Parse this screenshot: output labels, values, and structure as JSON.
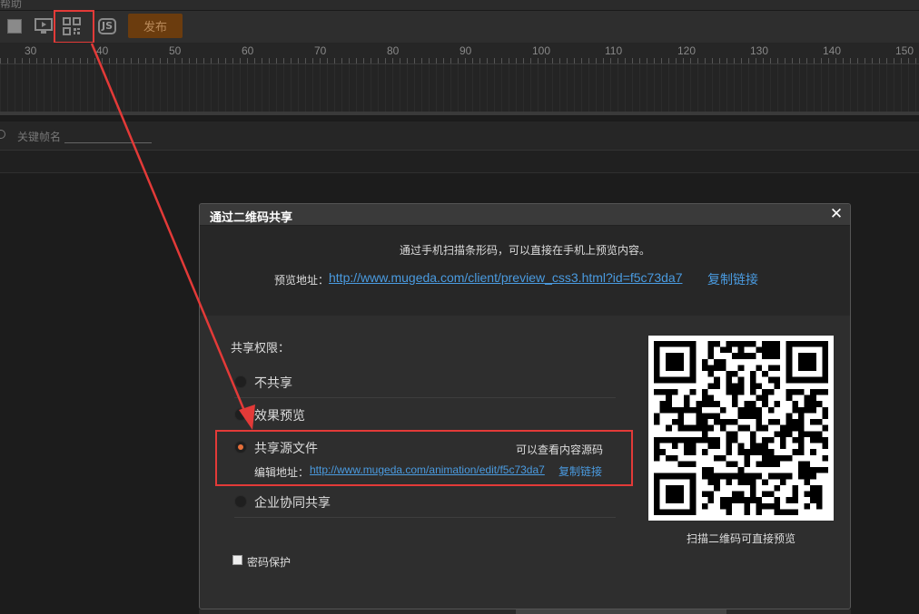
{
  "menubar": {
    "label": "帮助"
  },
  "toolbar": {
    "js_label": "JS",
    "publish_label": "发布",
    "icons": [
      "stop-icon",
      "preview-icon",
      "qrcode-icon",
      "js-icon"
    ]
  },
  "ruler": {
    "ticks": [
      "30",
      "40",
      "50",
      "60",
      "70",
      "80",
      "90",
      "100",
      "110",
      "120",
      "130",
      "140",
      "150"
    ]
  },
  "keyframe": {
    "label": "关键帧名"
  },
  "dialog": {
    "title": "通过二维码共享",
    "close": "✕",
    "description": "通过手机扫描条形码，可以直接在手机上预览内容。",
    "preview_label": "预览地址：",
    "preview_url": "http://www.mugeda.com/client/preview_css3.html?id=f5c73da7",
    "copy_link": "复制链接",
    "permission_title": "共享权限：",
    "options": [
      {
        "label": "不共享",
        "selected": false
      },
      {
        "label": "效果预览",
        "selected": false
      },
      {
        "label": "共享源文件",
        "selected": true,
        "note": "可以查看内容源码",
        "edit_label": "编辑地址：",
        "edit_url": "http://www.mugeda.com/animation/edit/f5c73da7",
        "edit_copy": "复制链接"
      },
      {
        "label": "企业协同共享",
        "selected": false
      }
    ],
    "password_label": "密码保护",
    "password_checked": false,
    "qr_caption": "扫描二维码可直接预览"
  },
  "colors": {
    "accent_link": "#4a9be0",
    "annotation": "#e33a38",
    "radio_selected": "#e66f3a",
    "publish_bg": "#6b3c0e"
  }
}
